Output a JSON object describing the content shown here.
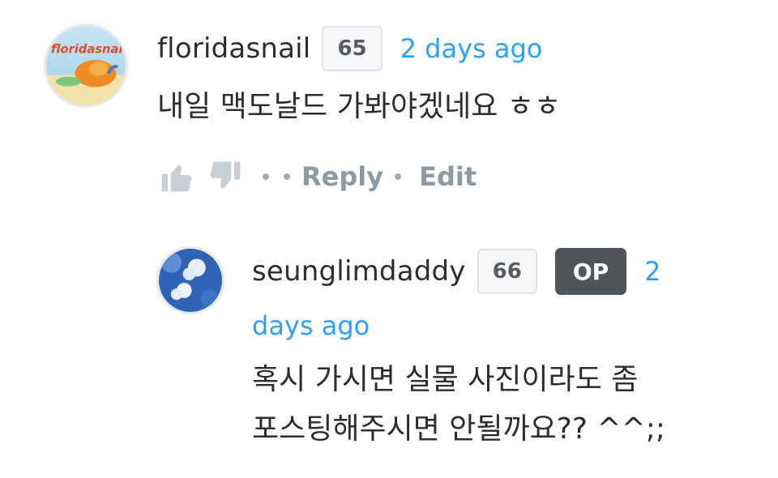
{
  "comments": [
    {
      "username": "floridasnail",
      "reputation": "65",
      "timestamp": "2 days ago",
      "avatar_text": "floridasnail",
      "message": "내일 맥도날드 가봐야겠네요 ㅎㅎ",
      "actions": {
        "reply": "Reply",
        "edit": "Edit"
      },
      "icons": {
        "upvote": "thumbs-up-icon",
        "downvote": "thumbs-down-icon"
      }
    },
    {
      "username": "seunglimdaddy",
      "reputation": "66",
      "badge": "OP",
      "timestamp_line1": "2",
      "timestamp_line2": "days ago",
      "message_line1": "혹시 가시면 실물 사진이라도 좀",
      "message_line2": "포스팅해주시면 안될까요?? ^^;;"
    }
  ],
  "colors": {
    "link": "#2e9fff",
    "text": "#2a2e2e",
    "muted": "#8e9aa3",
    "op_badge": "#505559"
  }
}
